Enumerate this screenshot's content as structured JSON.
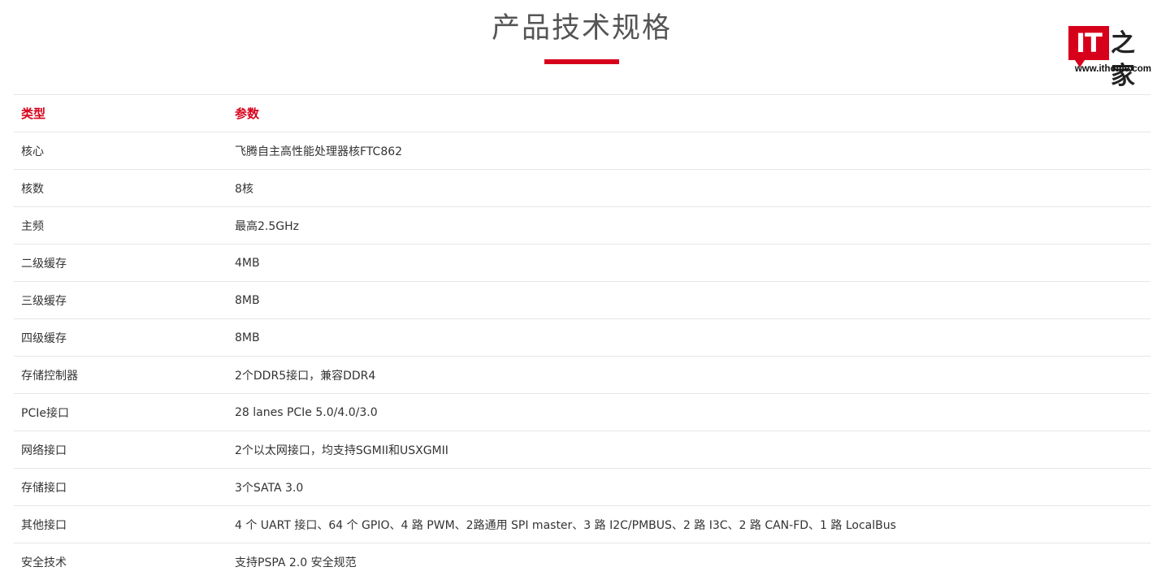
{
  "header": {
    "title": "产品技术规格"
  },
  "logo": {
    "mark_text": "IT",
    "han_text": "之家",
    "url": "www.ithome.com",
    "accent_color": "#d7001b"
  },
  "table": {
    "headers": {
      "type": "类型",
      "param": "参数"
    },
    "rows": [
      {
        "type": "核心",
        "param": "飞腾自主高性能处理器核FTC862"
      },
      {
        "type": "核数",
        "param": "8核"
      },
      {
        "type": "主频",
        "param": "最高2.5GHz"
      },
      {
        "type": "二级缓存",
        "param": "4MB"
      },
      {
        "type": "三级缓存",
        "param": "8MB"
      },
      {
        "type": "四级缓存",
        "param": "8MB"
      },
      {
        "type": "存储控制器",
        "param": "2个DDR5接口，兼容DDR4"
      },
      {
        "type": "PCIe接口",
        "param": "28 lanes PCIe 5.0/4.0/3.0"
      },
      {
        "type": "网络接口",
        "param": "2个以太网接口，均支持SGMII和USXGMII"
      },
      {
        "type": "存储接口",
        "param": "3个SATA 3.0"
      },
      {
        "type": "其他接口",
        "param": "4 个 UART 接口、64 个 GPIO、4 路 PWM、2路通用 SPI master、3 路 I2C/PMBUS、2 路 I3C、2 路 CAN-FD、1 路 LocalBus"
      },
      {
        "type": "安全技术",
        "param": "支持PSPA 2.0 安全规范"
      }
    ]
  }
}
